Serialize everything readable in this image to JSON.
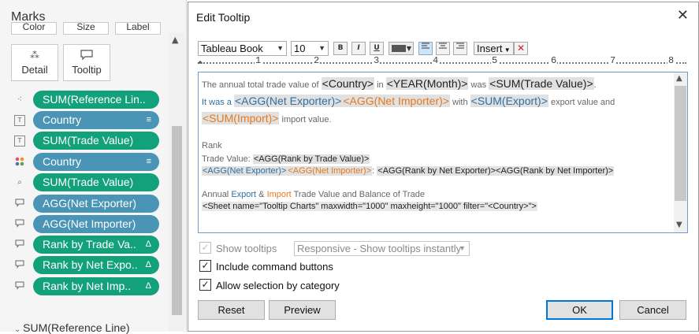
{
  "marks": {
    "title": "Marks",
    "top_buttons": [
      "Color",
      "Size",
      "Label"
    ],
    "cards": [
      {
        "label": "Detail",
        "icon": "detail-icon",
        "glyph": "⁂"
      },
      {
        "label": "Tooltip",
        "icon": "tooltip-icon",
        "glyph": "🗨"
      }
    ],
    "pills": [
      {
        "icon_glyph": "⁖",
        "label": "SUM(Reference Lin..",
        "color": "green",
        "suffix": ""
      },
      {
        "icon_glyph": "T",
        "label": "Country",
        "color": "blue",
        "suffix": "≡"
      },
      {
        "icon_glyph": "T",
        "label": "SUM(Trade Value)",
        "color": "green",
        "suffix": ""
      },
      {
        "icon_glyph": "⁘",
        "label": "Country",
        "color": "blue",
        "suffix": "≡"
      },
      {
        "icon_glyph": "⌕",
        "label": "SUM(Trade Value)",
        "color": "green",
        "suffix": ""
      },
      {
        "icon_glyph": "▭",
        "label": "AGG(Net Exporter)",
        "color": "blue",
        "suffix": ""
      },
      {
        "icon_glyph": "▭",
        "label": "AGG(Net Importer)",
        "color": "blue",
        "suffix": ""
      },
      {
        "icon_glyph": "▭",
        "label": "Rank by Trade Va..",
        "color": "green",
        "suffix": "Δ"
      },
      {
        "icon_glyph": "▭",
        "label": "Rank by Net Expo..",
        "color": "green",
        "suffix": "Δ"
      },
      {
        "icon_glyph": "▭",
        "label": "Rank by Net Imp..",
        "color": "green",
        "suffix": "Δ"
      }
    ],
    "bottom_item": "SUM(Reference Line)"
  },
  "dialog": {
    "title": "Edit Tooltip",
    "toolbar": {
      "font": "Tableau Book",
      "size": "10",
      "bold": "B",
      "italic": "I",
      "underline": "U",
      "insert": "Insert",
      "text_color": "#555555"
    },
    "ruler_numbers": [
      "1",
      "2",
      "3",
      "4",
      "5",
      "6",
      "7",
      "8"
    ],
    "editor": {
      "l1": {
        "a": "The annual total trade value of ",
        "b": "<Country>",
        "c": " in ",
        "d": "<YEAR(Month)>",
        "e": " was ",
        "f": "<SUM(Trade Value)>",
        "g": "."
      },
      "l2": {
        "a": "It was a ",
        "b": "<AGG(Net Exporter)>",
        "c": "<AGG(Net Importer)>",
        "d": " with ",
        "e": "<SUM(Export)>",
        "f": " export value and"
      },
      "l3": {
        "a": "<SUM(Import)>",
        "b": " import value."
      },
      "l5": "Rank",
      "l6": {
        "a": "Trade Value: ",
        "b": "<AGG(Rank by Trade Value)>"
      },
      "l7": {
        "a": "<AGG(Net Exporter)>",
        "b": "<AGG(Net Importer)>",
        "c": ": ",
        "d": "<AGG(Rank by Net Exporter)><AGG(Rank by Net Importer)>"
      },
      "l9": {
        "a": "Annual ",
        "b": "Export",
        "c": " & ",
        "d": "Import",
        "e": " Trade Value and Balance of Trade"
      },
      "l10": "<Sheet name=\"Tooltip Charts\" maxwidth=\"1000\" maxheight=\"1000\" filter=\"<Country>\">"
    },
    "options": {
      "show_tooltips": {
        "label": "Show tooltips",
        "checked": true,
        "enabled": false
      },
      "responsive": "Responsive - Show tooltips instantly",
      "include_commands": {
        "label": "Include command buttons",
        "checked": true
      },
      "allow_selection": {
        "label": "Allow selection by category",
        "checked": true
      }
    },
    "buttons": {
      "reset": "Reset",
      "preview": "Preview",
      "ok": "OK",
      "cancel": "Cancel"
    }
  }
}
